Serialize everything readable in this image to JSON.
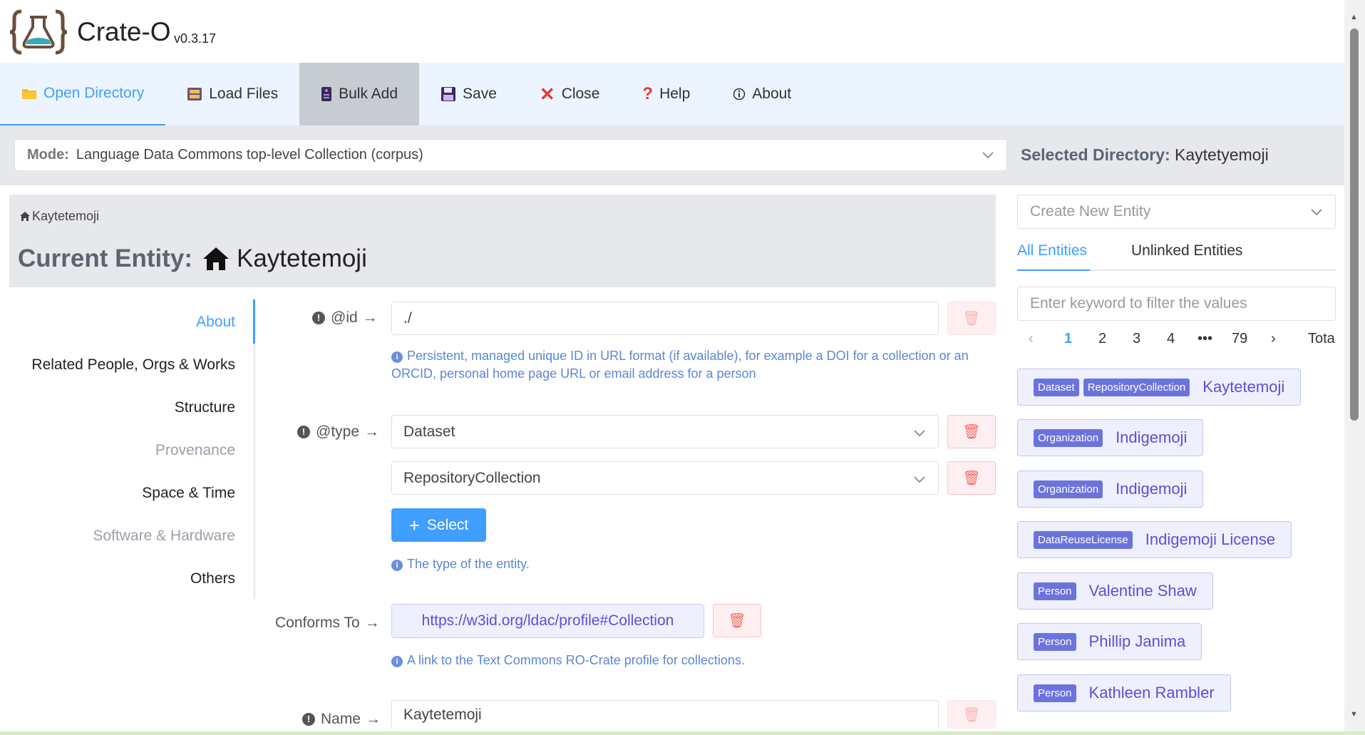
{
  "app": {
    "title": "Crate-O",
    "version": "v0.3.17"
  },
  "toolbar": [
    {
      "label": "Open Directory",
      "icon": "folder-icon"
    },
    {
      "label": "Load Files",
      "icon": "cabinet-icon"
    },
    {
      "label": "Bulk Add",
      "icon": "server-icon"
    },
    {
      "label": "Save",
      "icon": "floppy-icon"
    },
    {
      "label": "Close",
      "icon": "close-icon"
    },
    {
      "label": "Help",
      "icon": "question-icon"
    },
    {
      "label": "About",
      "icon": "info-icon"
    }
  ],
  "mode": {
    "label": "Mode:",
    "value": "Language Data Commons top-level Collection (corpus)"
  },
  "selected_directory": {
    "label": "Selected Directory:",
    "value": "Kaytetyemoji"
  },
  "breadcrumb": "Kaytetemoji",
  "current_entity": {
    "label": "Current Entity:",
    "name": "Kaytetemoji"
  },
  "nav": [
    "About",
    "Related People, Orgs & Works",
    "Structure",
    "Provenance",
    "Space & Time",
    "Software & Hardware",
    "Others"
  ],
  "form": {
    "id": {
      "label": "@id",
      "value": "./",
      "hint": "Persistent, managed unique ID in URL format (if available), for example a DOI for a collection or an ORCID, personal home page URL or email address for a person"
    },
    "type": {
      "label": "@type",
      "values": [
        "Dataset",
        "RepositoryCollection"
      ],
      "select_label": "Select",
      "hint": "The type of the entity."
    },
    "conforms_to": {
      "label": "Conforms To",
      "value": "https://w3id.org/ldac/profile#Collection",
      "hint": "A link to the Text Commons RO-Crate profile for collections."
    },
    "name": {
      "label": "Name",
      "value": "Kaytetemoji"
    }
  },
  "right": {
    "create_placeholder": "Create New Entity",
    "tabs": [
      "All Entities",
      "Unlinked Entities"
    ],
    "filter_placeholder": "Enter keyword to filter the values",
    "pager": {
      "prev": "‹",
      "pages": [
        "1",
        "2",
        "3",
        "4"
      ],
      "ellipsis": "•••",
      "last": "79",
      "next": "›",
      "total": "Tota"
    },
    "entities": [
      {
        "tags": [
          "Dataset",
          "RepositoryCollection"
        ],
        "name": "Kaytetemoji"
      },
      {
        "tags": [
          "Organization"
        ],
        "name": "Indigemoji"
      },
      {
        "tags": [
          "Organization"
        ],
        "name": "Indigemoji"
      },
      {
        "tags": [
          "DataReuseLicense"
        ],
        "name": "Indigemoji License"
      },
      {
        "tags": [
          "Person"
        ],
        "name": "Valentine Shaw"
      },
      {
        "tags": [
          "Person"
        ],
        "name": "Phillip Janima"
      },
      {
        "tags": [
          "Person"
        ],
        "name": "Kathleen Rambler"
      }
    ]
  },
  "colors": {
    "accent": "#409eff",
    "toolbar_bg": "#ecf5ff",
    "chip_text": "#5b4fd6",
    "tag_bg": "#6d73dc",
    "danger": "#f56c6c"
  }
}
